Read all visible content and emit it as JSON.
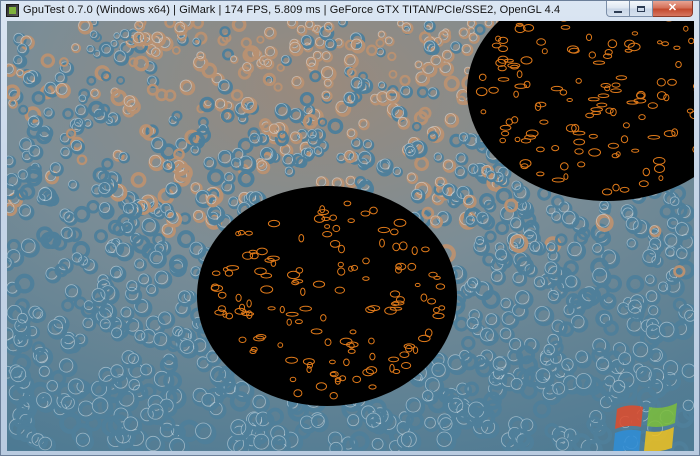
{
  "window": {
    "title": "GpuTest 0.7.0 (Windows x64) | GiMark | 174 FPS, 5.809 ms | GeForce GTX TITAN/PCIe/SSE2, OpenGL 4.4",
    "icons": {
      "app": "gputest-app-icon",
      "minimize": "minimize-icon",
      "maximize": "maximize-icon",
      "close": "close-icon"
    },
    "close_glyph": "✕"
  },
  "scene": {
    "description_icon": "donut-field-render",
    "colors": {
      "torus_blue": "#4f7f9a",
      "torus_highlight": "#dbe4ea",
      "torus_tan": "#b89172",
      "void_black": "#000000",
      "glow_orange": "#e07a1a"
    }
  },
  "watermark": {
    "icon": "windows-logo-watermark",
    "colors": [
      "#e24b2a",
      "#7cbf3a",
      "#2f8ed8",
      "#f0c21f"
    ]
  }
}
